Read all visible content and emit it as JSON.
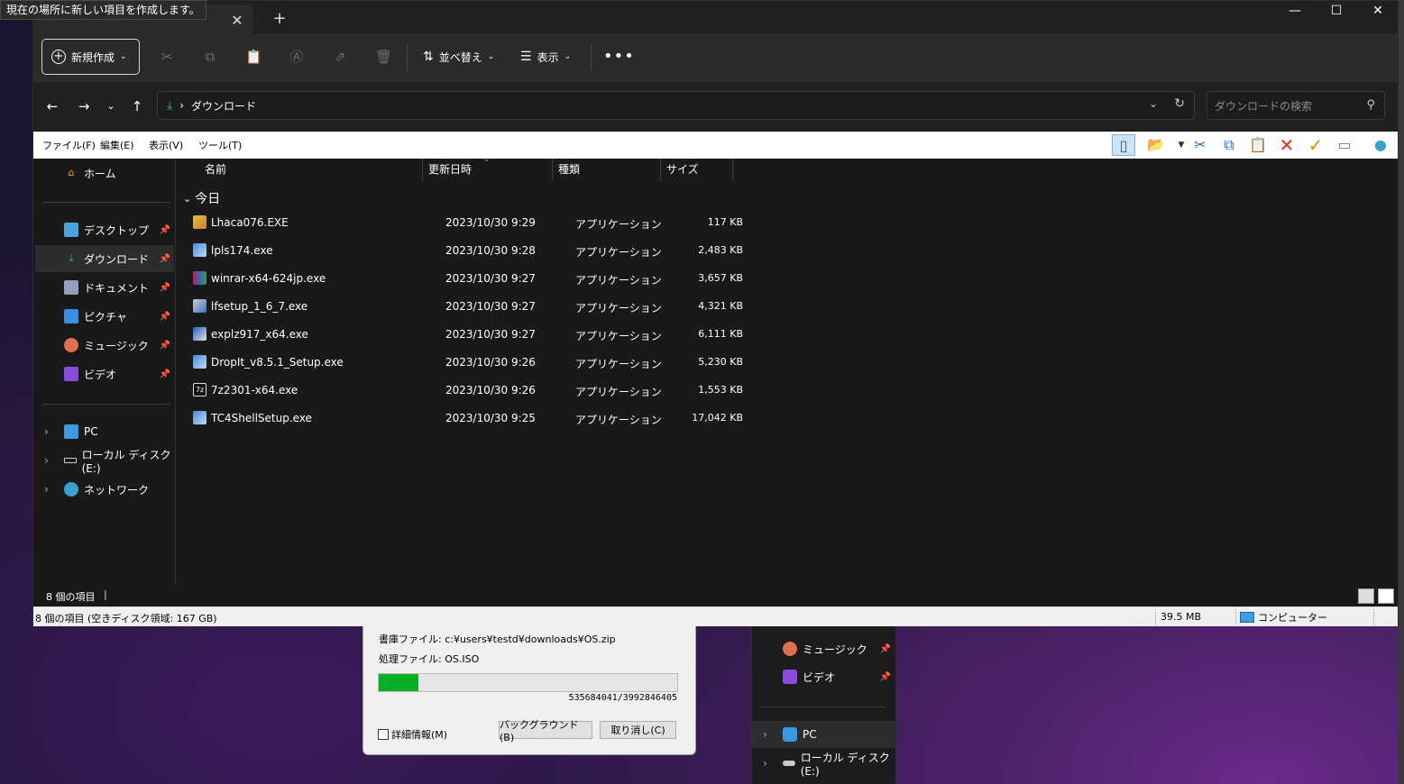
{
  "tooltip": "現在の場所に新しい項目を作成します。",
  "window": {
    "new_tab": "+",
    "close_tab": "✕",
    "minimize": "—",
    "maximize": "☐",
    "close": "✕"
  },
  "commandbar": {
    "new": "新規作成",
    "sort": "並べ替え",
    "view": "表示",
    "more": "•••"
  },
  "address": {
    "separator": "›",
    "location": "ダウンロード",
    "search_placeholder": "ダウンロードの検索"
  },
  "menubar": [
    "ファイル(F)",
    "編集(E)",
    "表示(V)",
    "ツール(T)"
  ],
  "sidebar": {
    "home": "ホーム",
    "quick_access": [
      {
        "label": "デスクトップ",
        "icon": "desktop-icon",
        "color": "#4aa3e0"
      },
      {
        "label": "ダウンロード",
        "icon": "download-icon",
        "color": "#3fb950"
      },
      {
        "label": "ドキュメント",
        "icon": "document-icon",
        "color": "#8fa3c0"
      },
      {
        "label": "ピクチャ",
        "icon": "picture-icon",
        "color": "#3a8ee0"
      },
      {
        "label": "ミュージック",
        "icon": "music-icon",
        "color": "#e07050"
      },
      {
        "label": "ビデオ",
        "icon": "video-icon",
        "color": "#8a4ae0"
      }
    ],
    "tree": [
      {
        "label": "PC",
        "icon": "pc-icon"
      },
      {
        "label": "ローカル ディスク (E:)",
        "icon": "drive-icon"
      },
      {
        "label": "ネットワーク",
        "icon": "network-icon"
      }
    ]
  },
  "columns": {
    "name": "名前",
    "modified": "更新日時",
    "type": "種類",
    "size": "サイズ"
  },
  "group": "今日",
  "files": [
    {
      "name": "Lhaca076.EXE",
      "date": "2023/10/30 9:29",
      "type": "アプリケーション",
      "size": "117 KB"
    },
    {
      "name": "lpls174.exe",
      "date": "2023/10/30 9:28",
      "type": "アプリケーション",
      "size": "2,483 KB"
    },
    {
      "name": "winrar-x64-624jp.exe",
      "date": "2023/10/30 9:27",
      "type": "アプリケーション",
      "size": "3,657 KB"
    },
    {
      "name": "lfsetup_1_6_7.exe",
      "date": "2023/10/30 9:27",
      "type": "アプリケーション",
      "size": "4,321 KB"
    },
    {
      "name": "explz917_x64.exe",
      "date": "2023/10/30 9:27",
      "type": "アプリケーション",
      "size": "6,111 KB"
    },
    {
      "name": "DropIt_v8.5.1_Setup.exe",
      "date": "2023/10/30 9:26",
      "type": "アプリケーション",
      "size": "5,230 KB"
    },
    {
      "name": "7z2301-x64.exe",
      "date": "2023/10/30 9:26",
      "type": "アプリケーション",
      "size": "1,553 KB"
    },
    {
      "name": "TC4ShellSetup.exe",
      "date": "2023/10/30 9:25",
      "type": "アプリケーション",
      "size": "17,042 KB"
    }
  ],
  "status": {
    "count": "8 個の項目"
  },
  "classic_status": {
    "items": "8 個の項目 (空きディスク領域: 167 GB)",
    "size": "39.5 MB",
    "location": "コンピューター"
  },
  "progress_dialog": {
    "archive": "書庫ファイル: c:¥users¥testd¥downloads¥OS.zip",
    "processing": "処理ファイル: OS.ISO",
    "progress": 0.134,
    "counter": "535684041/3992846405",
    "details": "詳細情報(M)",
    "background": "バックグラウンド(B)",
    "cancel": "取り消し(C)",
    "bar_color": "#06b025"
  },
  "bg_explorer": {
    "items": [
      {
        "label": "ミュージック"
      },
      {
        "label": "ビデオ"
      },
      {
        "label": "PC"
      },
      {
        "label": "ローカル ディスク (E:)"
      }
    ]
  }
}
